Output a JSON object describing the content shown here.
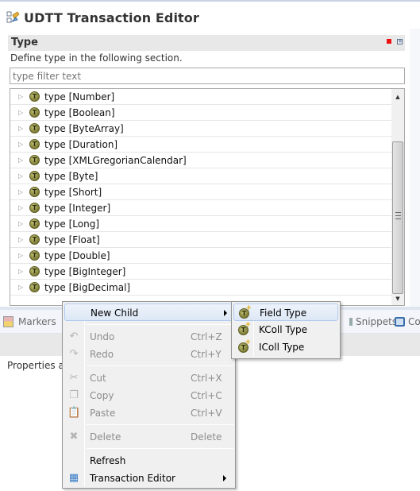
{
  "editor": {
    "title": "UDTT Transaction Editor",
    "icon": "transaction-editor-icon"
  },
  "section": {
    "title": "Type",
    "description": "Define type in the following section.",
    "status_icon": "red-square-icon",
    "expand_icon": "expand-plus-icon"
  },
  "filter": {
    "placeholder": "type filter text",
    "value": "type filter text"
  },
  "tree": {
    "items": [
      {
        "label": "type [Number]",
        "icon": "type-t-icon"
      },
      {
        "label": "type [Boolean]",
        "icon": "type-t-icon"
      },
      {
        "label": "type [ByteArray]",
        "icon": "type-t-icon"
      },
      {
        "label": "type [Duration]",
        "icon": "type-t-icon"
      },
      {
        "label": "type [XMLGregorianCalendar]",
        "icon": "type-t-icon"
      },
      {
        "label": "type [Byte]",
        "icon": "type-t-icon"
      },
      {
        "label": "type [Short]",
        "icon": "type-t-icon"
      },
      {
        "label": "type [Integer]",
        "icon": "type-t-icon"
      },
      {
        "label": "type [Long]",
        "icon": "type-t-icon"
      },
      {
        "label": "type [Float]",
        "icon": "type-t-icon"
      },
      {
        "label": "type [Double]",
        "icon": "type-t-icon"
      },
      {
        "label": "type [BigInteger]",
        "icon": "type-t-icon"
      },
      {
        "label": "type [BigDecimal]",
        "icon": "type-t-icon"
      }
    ],
    "icon_glyph": "T"
  },
  "bottom_panel": {
    "tabs": [
      {
        "label": "Markers",
        "icon": "markers-icon"
      },
      {
        "label": "Snippets",
        "icon": "snippets-icon"
      },
      {
        "label": "Co",
        "icon": "console-icon"
      }
    ],
    "properties_text": "Properties a"
  },
  "context_menu": {
    "items": [
      {
        "label": "New Child",
        "shortcut": "",
        "submenu": true,
        "enabled": true,
        "icon": ""
      },
      {
        "label": "Undo",
        "shortcut": "Ctrl+Z",
        "enabled": false,
        "icon": "undo-icon"
      },
      {
        "label": "Redo",
        "shortcut": "Ctrl+Y",
        "enabled": false,
        "icon": "redo-icon"
      },
      {
        "label": "Cut",
        "shortcut": "Ctrl+X",
        "enabled": false,
        "icon": "cut-icon"
      },
      {
        "label": "Copy",
        "shortcut": "Ctrl+C",
        "enabled": false,
        "icon": "copy-icon"
      },
      {
        "label": "Paste",
        "shortcut": "Ctrl+V",
        "enabled": false,
        "icon": "paste-icon"
      },
      {
        "label": "Delete",
        "shortcut": "Delete",
        "enabled": false,
        "icon": "delete-icon"
      },
      {
        "label": "Refresh",
        "shortcut": "",
        "enabled": true,
        "icon": ""
      },
      {
        "label": "Transaction Editor",
        "shortcut": "",
        "submenu": true,
        "enabled": true,
        "icon": "transaction-editor-icon"
      }
    ]
  },
  "submenu": {
    "items": [
      {
        "label": "Field Type",
        "icon": "new-type-icon"
      },
      {
        "label": "KColl Type",
        "icon": "new-type-icon"
      },
      {
        "label": "IColl Type",
        "icon": "new-type-icon"
      }
    ]
  },
  "colors": {
    "menu_highlight_border": "#aecaf0",
    "section_header_bg": "#e8e8e8",
    "type_icon": "#8c8a40"
  }
}
